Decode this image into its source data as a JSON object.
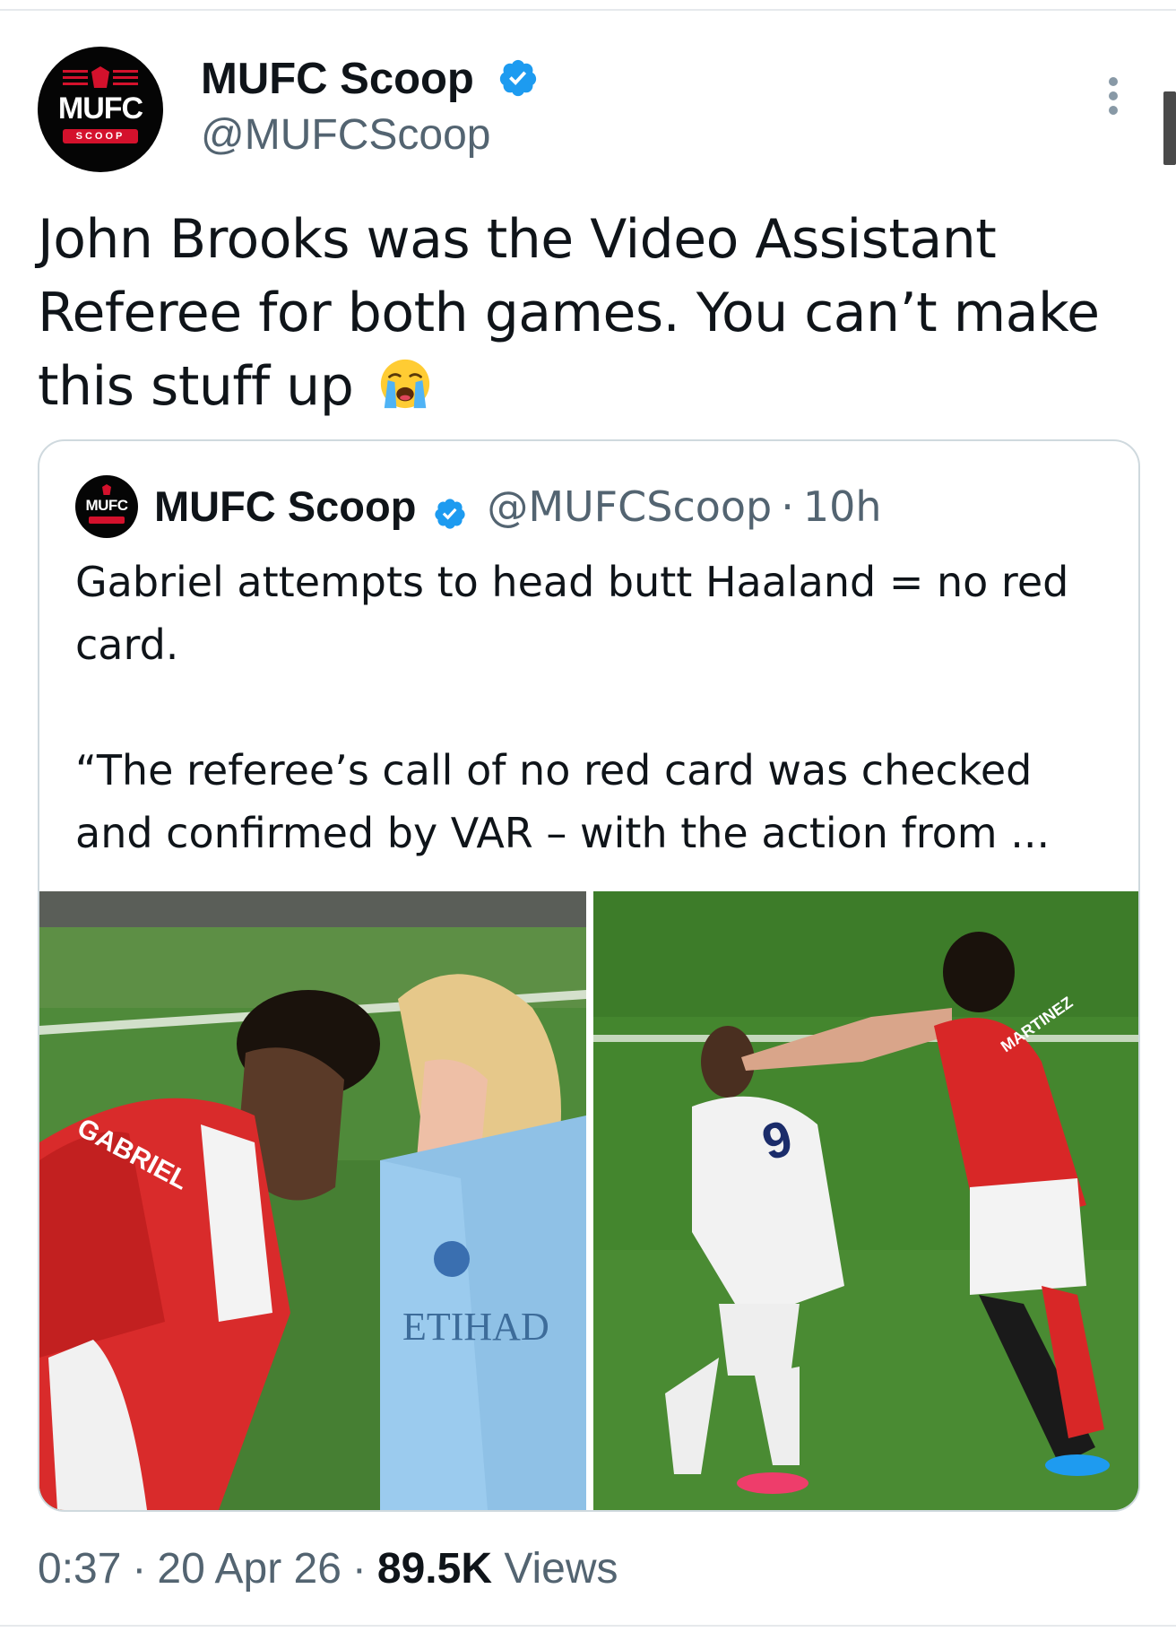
{
  "author": {
    "display_name": "MUFC Scoop",
    "handle": "@MUFCScoop",
    "avatar_logo_text": "MUFC",
    "avatar_logo_sub": "SCOOP",
    "verified": true
  },
  "tweet": {
    "text": "John Brooks was the Video Assistant Referee for both games. You can’t make this stuff up",
    "emoji": "loudly-crying-face"
  },
  "quoted_tweet": {
    "display_name": "MUFC Scoop",
    "handle": "@MUFCScoop",
    "separator": "·",
    "time": "10h",
    "paragraphs": [
      "Gabriel attempts to head butt Haaland = no red card.",
      "“The referee’s call of no red card was checked and confirmed by VAR – with the action from ..."
    ],
    "media": [
      {
        "name": "media-left",
        "jersey_text": "GABRIEL",
        "sponsor_text": "ETIHAD"
      },
      {
        "name": "media-right",
        "jersey_number": "9",
        "jersey_text": "MARTINEZ"
      }
    ]
  },
  "meta": {
    "time": "0:37",
    "date": "20 Apr 26",
    "sep": "·",
    "views_count": "89.5K",
    "views_label": "Views"
  },
  "colors": {
    "text_primary": "#0f1419",
    "text_secondary": "#536471",
    "verified_blue": "#1d9bf0",
    "border": "#cfd9de",
    "brand_red": "#d4112c"
  }
}
